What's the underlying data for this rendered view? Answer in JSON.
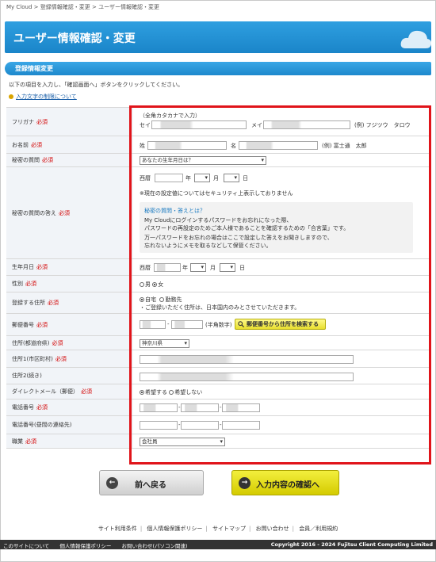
{
  "breadcrumb": [
    "My Cloud",
    "登録情報確認・変更",
    "ユーザー情報確認・変更"
  ],
  "breadcrumb_sep": ">",
  "page_title": "ユーザー情報確認・変更",
  "section_title": "登録情報変更",
  "intro": "以下の項目を入力し、「確認画面へ」ボタンをクリックしてください。",
  "char_limit_link": "入力文字の制限について",
  "required": "必須",
  "fields": {
    "furigana": {
      "label": "フリガナ",
      "note": "（全角カタカナで入力）",
      "sei": "セイ",
      "mei": "メイ",
      "example": "(例) フジツウ　タロウ"
    },
    "name": {
      "label": "お名前",
      "sei": "姓",
      "mei": "名",
      "example": "(例) 富士通　太郎"
    },
    "secret_q": {
      "label": "秘密の質問",
      "value": "あなたの生年月日は？"
    },
    "secret_a": {
      "label": "秘密の質問の答え",
      "era": "西暦",
      "year": "年",
      "month": "月",
      "day": "日",
      "security_note": "※現在の設定値についてはセキュリティ上表示しておりません",
      "hint_title": "秘密の質問・答えとは？",
      "hint_lines": [
        "My Cloudにログインするパスワードをお忘れになった際、",
        "パスワードの再設定のためご本人様であることを確認するための「合言葉」です。",
        "万一パスワードをお忘れの場合はここで設定した答えをお聞きしますので、",
        "忘れないようにメモを取るなどして保管ください。"
      ]
    },
    "birthday": {
      "label": "生年月日",
      "era": "西暦",
      "year": "年",
      "month": "月",
      "day": "日"
    },
    "gender": {
      "label": "性別",
      "male": "男",
      "female": "女"
    },
    "address_type": {
      "label": "登録する住所",
      "home": "自宅",
      "work": "勤務先",
      "note": "・ご登録いただく住所は、日本国内のみとさせていただきます。"
    },
    "postal": {
      "label": "郵便番号",
      "note": "(半角数字)",
      "search_button": "郵便番号から住所を検索する"
    },
    "prefecture": {
      "label": "住所(都道府県)",
      "value": "神奈川県"
    },
    "address1": {
      "label": "住所1(市区町村)"
    },
    "address2": {
      "label": "住所2(続き)"
    },
    "direct_mail": {
      "label": "ダイレクトメール（郵便）",
      "yes": "希望する",
      "no": "希望しない"
    },
    "phone": {
      "label": "電話番号"
    },
    "phone_day": {
      "label": "電話番号(昼間の連絡先)"
    },
    "occupation": {
      "label": "職業",
      "value": "会社員"
    }
  },
  "buttons": {
    "back": "前へ戻る",
    "next": "入力内容の確認へ"
  },
  "footer_links": [
    "サイト利用条件",
    "個人情報保護ポリシー",
    "サイトマップ",
    "お問い合わせ",
    "会員／利用規約"
  ],
  "footer_bar": {
    "left": [
      "このサイトについて",
      "個人情報保護ポリシー",
      "お問い合わせ(パソコン関連)"
    ],
    "copyright": "Copyright 2016 - 2024 Fujitsu Client Computing Limited"
  },
  "colors": {
    "header": "#1a85c9",
    "highlight_box": "#e0141a",
    "required": "#d20000",
    "next_button": "#e8df2d"
  }
}
